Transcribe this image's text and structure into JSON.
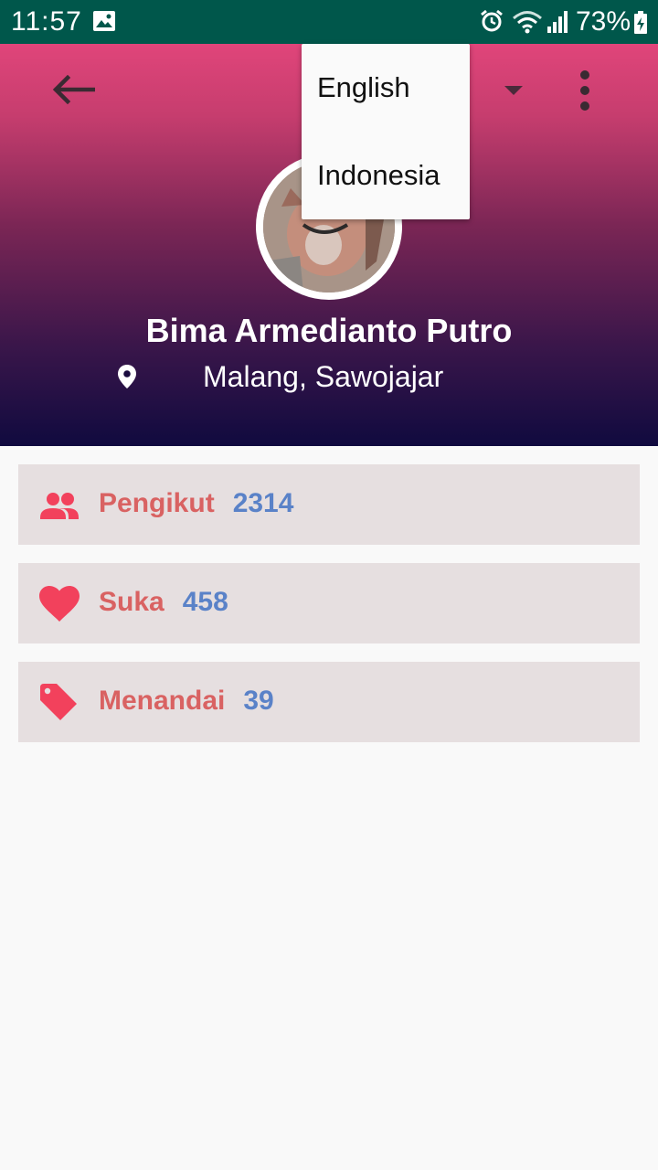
{
  "status_bar": {
    "time": "11:57",
    "battery_percent": "73%",
    "icons": [
      "gallery-icon",
      "alarm-icon",
      "wifi-icon",
      "signal-icon",
      "battery-charging-icon"
    ]
  },
  "toolbar": {
    "back_icon": "arrow-left-icon",
    "spinner_icon": "dropdown-arrow-icon",
    "overflow_icon": "more-vert-icon"
  },
  "language_menu": {
    "options": [
      "English",
      "Indonesia"
    ]
  },
  "profile": {
    "name": "Bima Armedianto Putro",
    "location": "Malang, Sawojajar"
  },
  "stats": [
    {
      "icon": "people-icon",
      "label": "Pengikut",
      "value": "2314"
    },
    {
      "icon": "heart-icon",
      "label": "Suka",
      "value": "458"
    },
    {
      "icon": "tag-icon",
      "label": "Menandai",
      "value": "39"
    }
  ],
  "colors": {
    "status_bar": "#00574b",
    "header_top": "#e0457a",
    "header_bottom": "#100a3f",
    "stat_card_bg": "#e6dfe0",
    "stat_label": "#d96262",
    "stat_value": "#5a82c8",
    "stat_icon": "#f2415c"
  }
}
